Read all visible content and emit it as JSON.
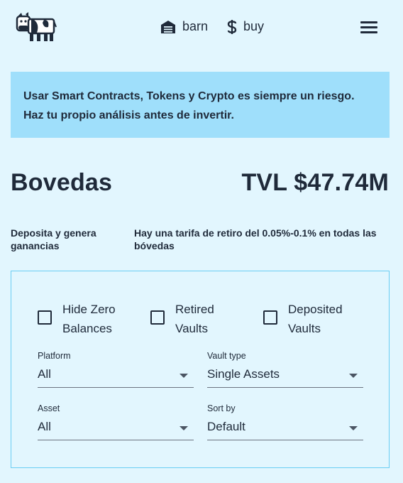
{
  "header": {
    "logo_icon": "cow-logo-icon",
    "nav": [
      {
        "label": "barn",
        "icon": "barn-icon"
      },
      {
        "label": "buy",
        "icon": "dollar-icon"
      }
    ],
    "menu_icon": "hamburger-menu-icon"
  },
  "banner": {
    "text": "Usar Smart Contracts, Tokens y Crypto es siempre un riesgo. Haz tu propio análisis antes de invertir.",
    "background": "#9fdffb"
  },
  "page": {
    "title": "Bovedas",
    "tvl": "TVL $47.74M",
    "subtitle_left": "Deposita y genera ganancias",
    "subtitle_right": "Hay una tarifa de retiro del 0.05%-0.1% en todas las bóvedas"
  },
  "filters": {
    "checkboxes": [
      {
        "label": "Hide Zero Balances",
        "checked": false
      },
      {
        "label": "Retired Vaults",
        "checked": false
      },
      {
        "label": "Deposited Vaults",
        "checked": false
      }
    ],
    "selects": {
      "platform": {
        "label": "Platform",
        "value": "All"
      },
      "vault_type": {
        "label": "Vault type",
        "value": "Single Assets"
      },
      "asset": {
        "label": "Asset",
        "value": "All"
      },
      "sort_by": {
        "label": "Sort by",
        "value": "Default"
      }
    }
  },
  "colors": {
    "background": "#e2f6fe",
    "text": "#1f2a3a",
    "panel_border": "#69cdf3"
  }
}
